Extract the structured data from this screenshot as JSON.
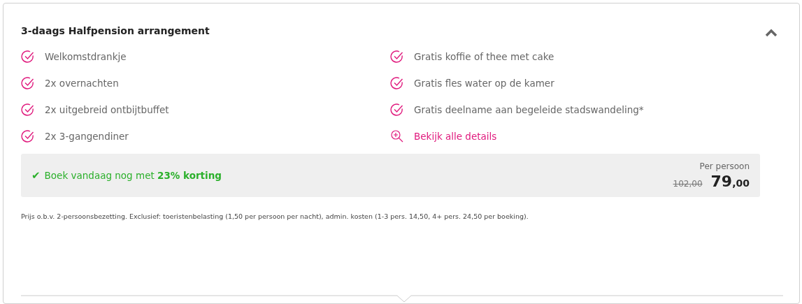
{
  "package": {
    "title": "3-daags Halfpension arrangement",
    "expanded": true,
    "features": [
      {
        "kind": "check",
        "label": "Welkomstdrankje"
      },
      {
        "kind": "check",
        "label": "2x overnachten"
      },
      {
        "kind": "check",
        "label": "2x uitgebreid ontbijtbuffet"
      },
      {
        "kind": "check",
        "label": "2x 3-gangendiner"
      },
      {
        "kind": "check",
        "label": "Gratis koffie of thee met cake"
      },
      {
        "kind": "check",
        "label": "Gratis fles water op de kamer"
      },
      {
        "kind": "check",
        "label": "Gratis deelname aan begeleide stadswandeling*"
      },
      {
        "kind": "link",
        "label": "Bekijk alle details"
      }
    ],
    "offer": {
      "icon": "✔",
      "text": "Boek vandaag nog met **23% korting**",
      "price_label": "Per persoon",
      "old_price": "102,00",
      "price_main": "79",
      "price_cents": ",00"
    },
    "footnote": "Prijs o.b.v. 2-persoonsbezetting. Exclusief: toeristenbelasting (1,50 per persoon per nacht), admin. kosten (1-3 pers. 14,50, 4+ pers. 24,50 per boeking)."
  }
}
